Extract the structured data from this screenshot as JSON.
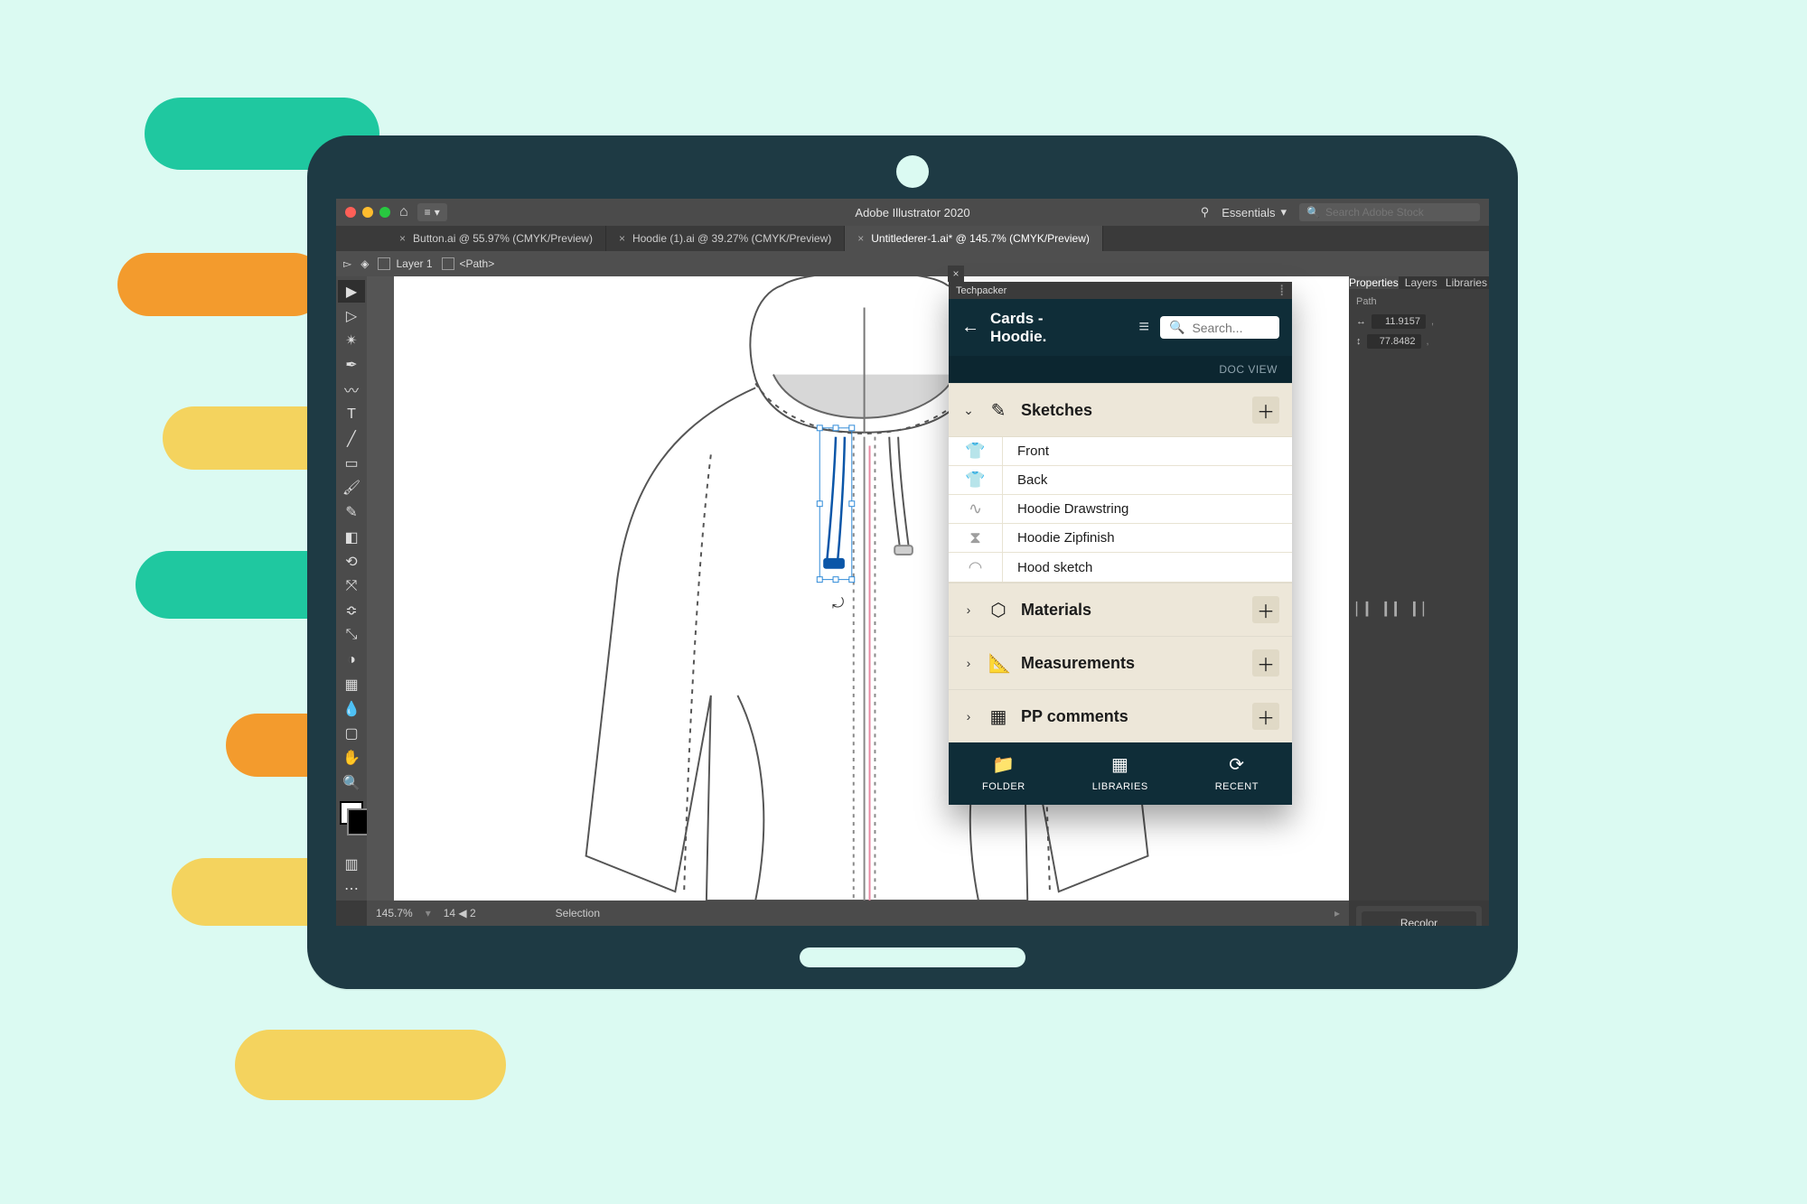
{
  "app": {
    "title": "Adobe Illustrator 2020",
    "workspace_label": "Essentials",
    "stock_placeholder": "Search Adobe Stock"
  },
  "document_tabs": [
    {
      "label": "Button.ai @ 55.97% (CMYK/Preview)",
      "active": false
    },
    {
      "label": "Hoodie (1).ai @ 39.27% (CMYK/Preview)",
      "active": false
    },
    {
      "label": "Untitlederer-1.ai* @ 145.7% (CMYK/Preview)",
      "active": true
    }
  ],
  "breadcrumb": {
    "layer_label": "Layer 1",
    "path_label": "<Path>"
  },
  "status": {
    "zoom": "145.7%",
    "artboard_nav": "14 ◀ 2",
    "mode": "Selection"
  },
  "right_dock": {
    "tabs": [
      "Properties",
      "Layers",
      "Libraries"
    ],
    "active_tab": "Properties",
    "section_label": "Path",
    "x_value": "11.9157",
    "y_value": "77.8482",
    "recolor_label": "Recolor"
  },
  "techpacker": {
    "tab_label": "Techpacker",
    "title_line1": "Cards -",
    "title_line2": "Hoodie.",
    "search_placeholder": "Search...",
    "docview_label": "DOC VIEW",
    "sections": [
      {
        "key": "sketches",
        "label": "Sketches",
        "expanded": true,
        "rows": [
          "Front",
          "Back",
          "Hoodie Drawstring",
          "Hoodie Zipfinish",
          "Hood sketch"
        ]
      },
      {
        "key": "materials",
        "label": "Materials",
        "expanded": false
      },
      {
        "key": "measurements",
        "label": "Measurements",
        "expanded": false
      },
      {
        "key": "ppcomments",
        "label": "PP comments",
        "expanded": false
      }
    ],
    "bottom_nav": [
      {
        "key": "folder",
        "label": "FOLDER"
      },
      {
        "key": "libraries",
        "label": "LIBRARIES"
      },
      {
        "key": "recent",
        "label": "RECENT"
      }
    ]
  }
}
